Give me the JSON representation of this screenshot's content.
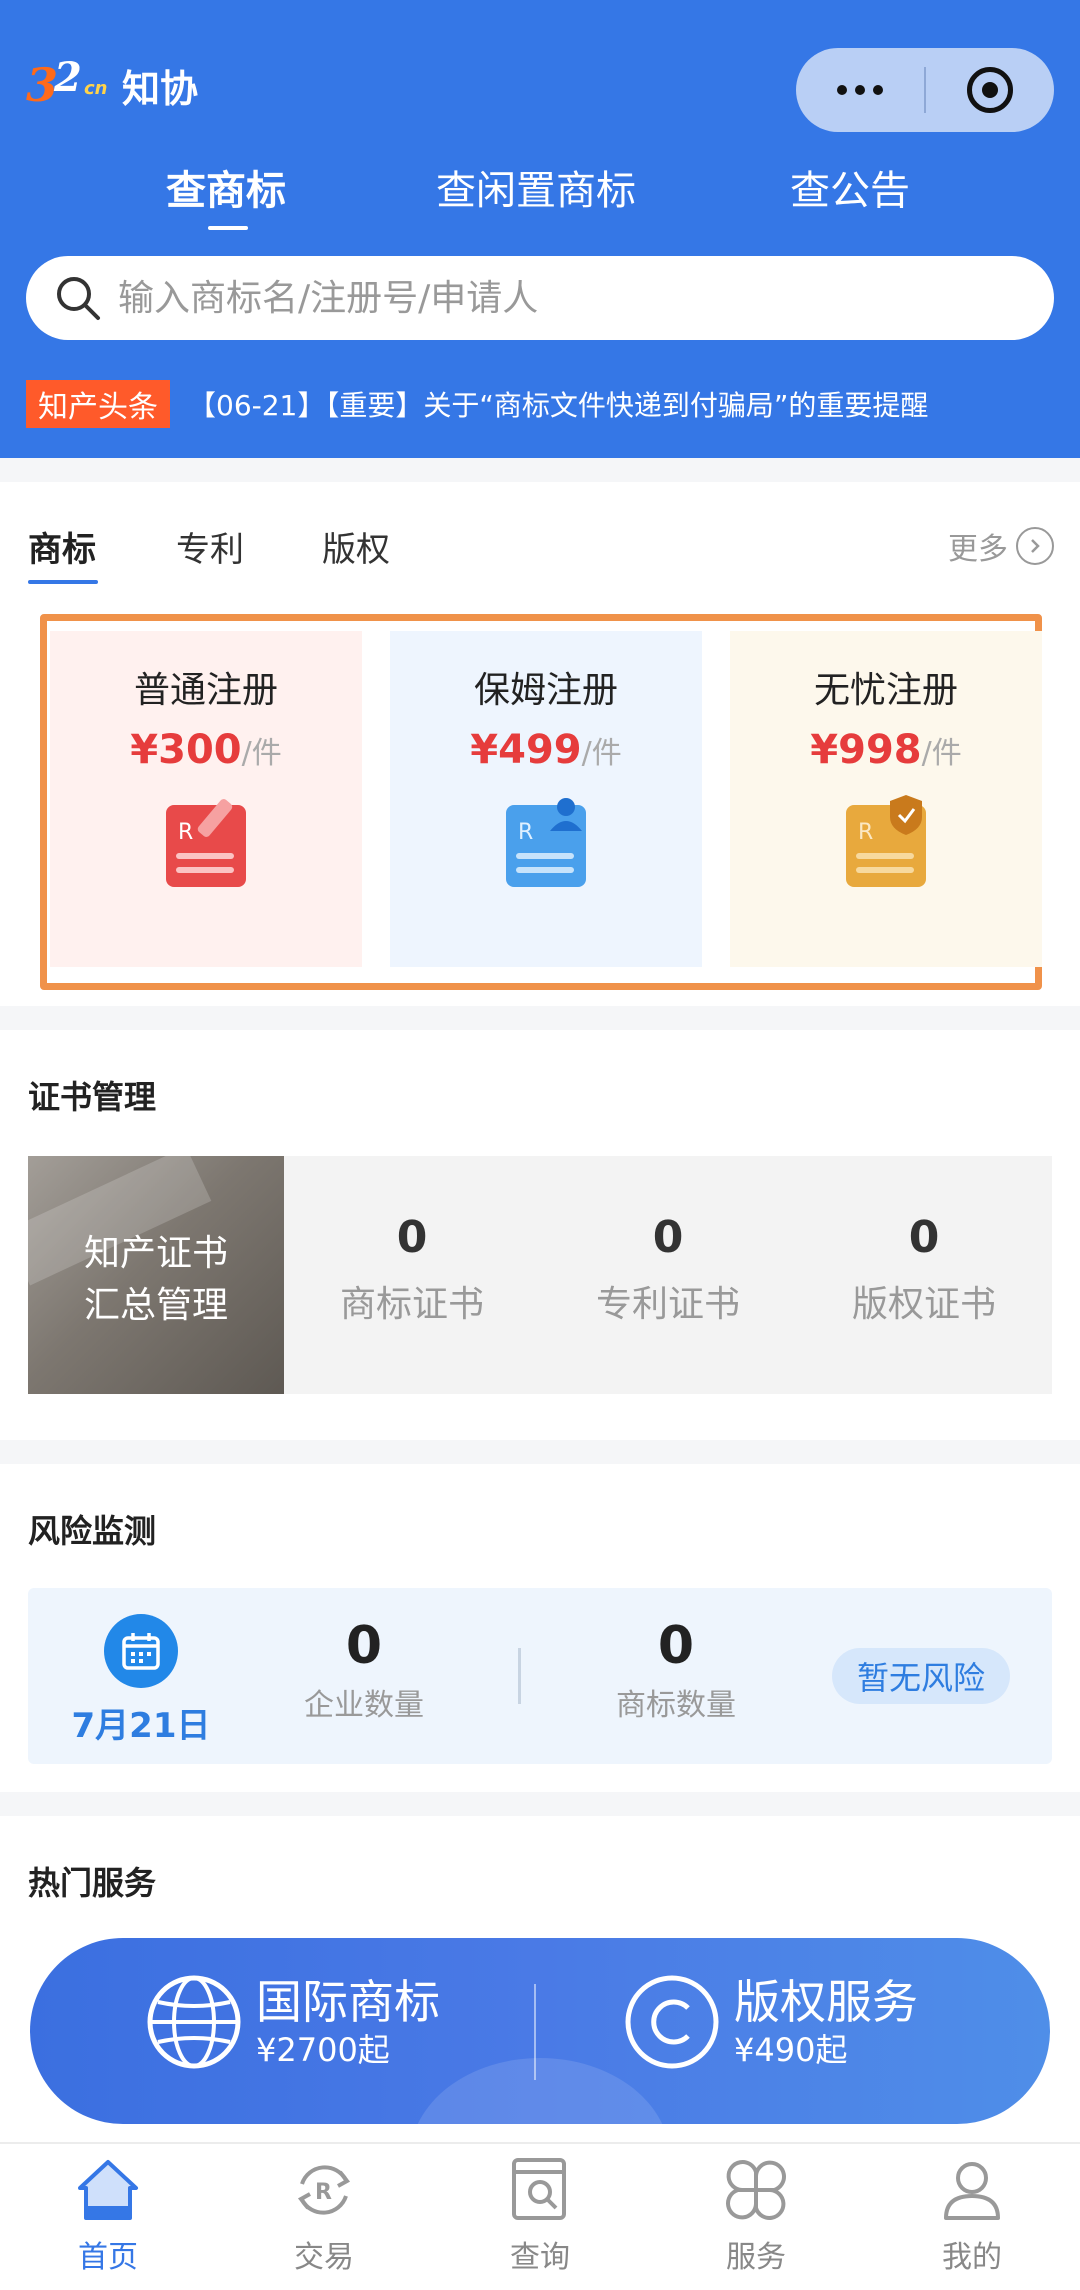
{
  "app": {
    "logo_number": "32",
    "logo_suffix": "cn",
    "logo_text": "知协"
  },
  "top_tabs": [
    {
      "label": "查商标",
      "active": true
    },
    {
      "label": "查闲置商标",
      "active": false
    },
    {
      "label": "查公告",
      "active": false
    }
  ],
  "search": {
    "placeholder": "输入商标名/注册号/申请人"
  },
  "news": {
    "badge": "知产头条",
    "text": "【06-21】【重要】关于“商标文件快递到付骗局”的重要提醒"
  },
  "category_tabs": [
    {
      "label": "商标",
      "active": true
    },
    {
      "label": "专利",
      "active": false
    },
    {
      "label": "版权",
      "active": false
    }
  ],
  "more_label": "更多",
  "plans": [
    {
      "name": "普通注册",
      "price": "¥300",
      "unit": "/件",
      "icon": "trademark-edit-icon",
      "bg": "#fff1ef"
    },
    {
      "name": "保姆注册",
      "price": "¥499",
      "unit": "/件",
      "icon": "trademark-person-icon",
      "bg": "#eef5fe"
    },
    {
      "name": "无忧注册",
      "price": "¥998",
      "unit": "/件",
      "icon": "trademark-shield-icon",
      "bg": "#fdf8ec"
    }
  ],
  "certificates": {
    "title": "证书管理",
    "image_line1": "知产证书",
    "image_line2": "汇总管理",
    "stats": [
      {
        "value": "0",
        "label": "商标证书"
      },
      {
        "value": "0",
        "label": "专利证书"
      },
      {
        "value": "0",
        "label": "版权证书"
      }
    ]
  },
  "risk": {
    "title": "风险监测",
    "date": "7月21日",
    "stats": [
      {
        "value": "0",
        "label": "企业数量"
      },
      {
        "value": "0",
        "label": "商标数量"
      }
    ],
    "badge": "暂无风险"
  },
  "hot_services": {
    "title": "热门服务",
    "items": [
      {
        "name": "国际商标",
        "price": "¥2700起",
        "icon": "globe-icon"
      },
      {
        "name": "版权服务",
        "price": "¥490起",
        "icon": "copyright-icon"
      }
    ]
  },
  "bottom_nav": [
    {
      "label": "首页",
      "icon": "home-icon",
      "active": true
    },
    {
      "label": "交易",
      "icon": "trade-icon",
      "active": false
    },
    {
      "label": "查询",
      "icon": "query-icon",
      "active": false
    },
    {
      "label": "服务",
      "icon": "service-icon",
      "active": false
    },
    {
      "label": "我的",
      "icon": "profile-icon",
      "active": false
    }
  ],
  "colors": {
    "brand_blue": "#3577e6",
    "price_red": "#e63c3c",
    "badge_orange": "#ff5a2a",
    "highlight_border": "#f0924a"
  }
}
